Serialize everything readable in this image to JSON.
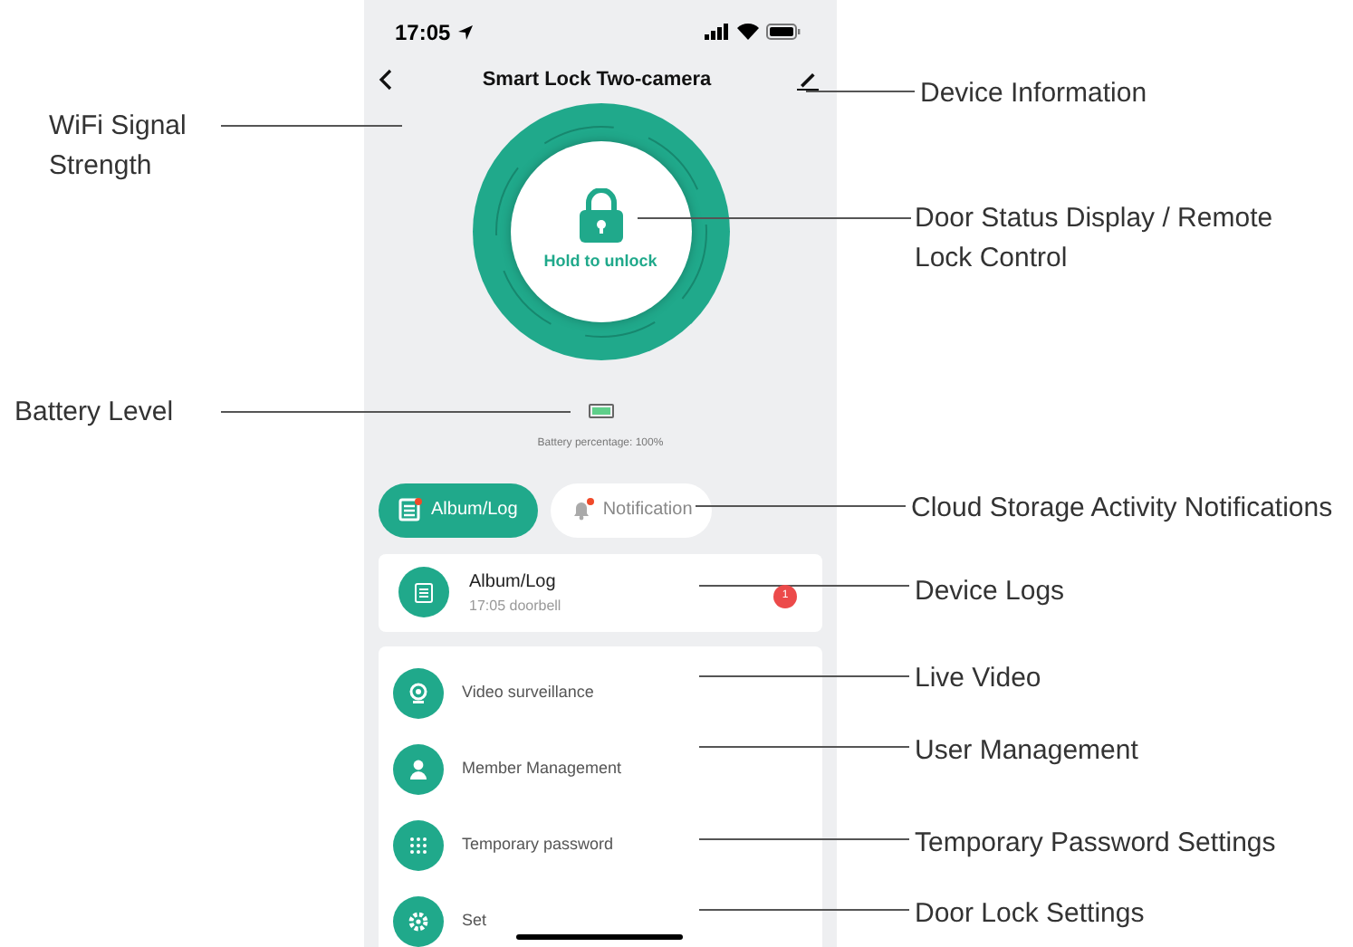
{
  "status_bar": {
    "time": "17:05"
  },
  "header": {
    "title": "Smart Lock Two-camera"
  },
  "lock_button": {
    "label": "Hold to unlock"
  },
  "battery": {
    "text": "Battery percentage: 100%"
  },
  "tabs": [
    {
      "label": "Album/Log",
      "selected": true,
      "unread": true
    },
    {
      "label": "Notification",
      "selected": false,
      "unread": true
    }
  ],
  "log_card": {
    "title": "Album/Log",
    "subtitle": "17:05 doorbell",
    "badge": "1"
  },
  "menu": [
    {
      "label": "Video surveillance",
      "kind": "camera"
    },
    {
      "label": "Member Management",
      "kind": "person"
    },
    {
      "label": "Temporary password",
      "kind": "keypad"
    },
    {
      "label": "Set",
      "kind": "gear"
    }
  ],
  "callouts": [
    {
      "text": "WiFi Signal Strength"
    },
    {
      "text": "Device Information"
    },
    {
      "text": "Door Status Display / Remote Lock Control"
    },
    {
      "text": "Battery Level"
    },
    {
      "text": "Cloud Storage Activity Notifications"
    },
    {
      "text": "Device Logs"
    },
    {
      "text": "Live Video"
    },
    {
      "text": "User Management"
    },
    {
      "text": "Temporary Password Settings"
    },
    {
      "text": "Door Lock Settings"
    }
  ]
}
